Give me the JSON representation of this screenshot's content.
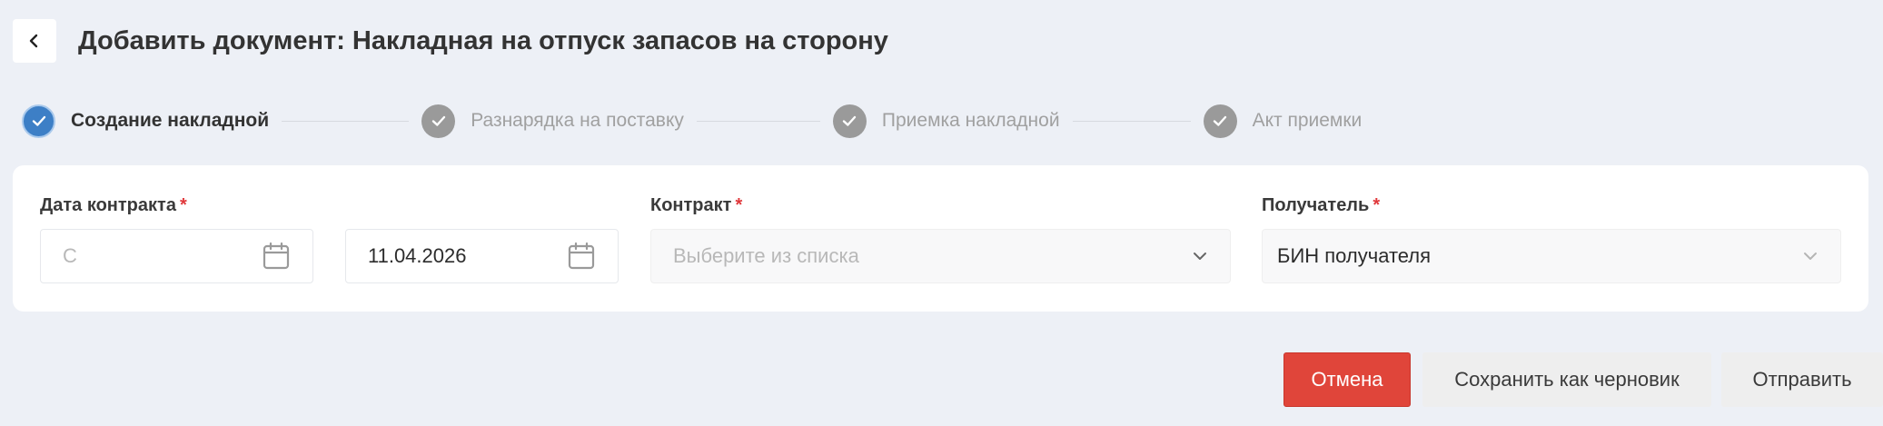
{
  "header": {
    "title": "Добавить документ: Накладная на отпуск запасов на сторону",
    "back_icon": "chevron-left-icon"
  },
  "stepper": {
    "steps": [
      {
        "label": "Создание накладной",
        "state": "active"
      },
      {
        "label": "Разнарядка на поставку",
        "state": "done"
      },
      {
        "label": "Приемка накладной",
        "state": "done"
      },
      {
        "label": "Акт приемки",
        "state": "done"
      }
    ]
  },
  "form": {
    "contract_date": {
      "label": "Дата контракта",
      "required_mark": "*",
      "from_placeholder": "С",
      "to_value": "11.04.2026"
    },
    "contract": {
      "label": "Контракт",
      "required_mark": "*",
      "placeholder": "Выберите из списка"
    },
    "recipient": {
      "label": "Получатель",
      "required_mark": "*",
      "value": "БИН получателя"
    }
  },
  "actions": {
    "cancel_label": "Отмена",
    "draft_label": "Сохранить как черновик",
    "send_label": "Отправить"
  },
  "colors": {
    "background": "#edf0f6",
    "active_step": "#3d7fc6",
    "done_step": "#9a9a9a",
    "required": "#e0383b",
    "cancel": "#e0453a"
  }
}
